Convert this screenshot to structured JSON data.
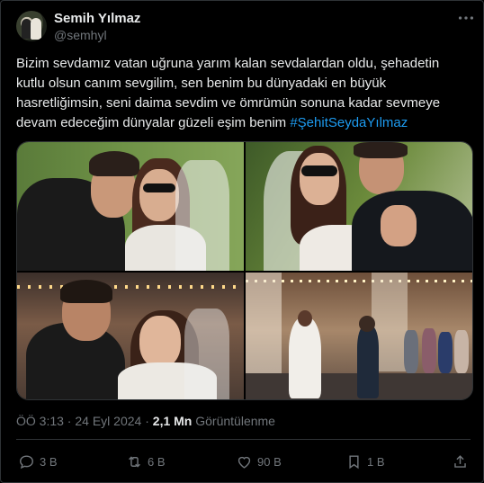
{
  "author": {
    "name": "Semih Yılmaz",
    "handle": "@semhyl",
    "avatar_icon": "profile-avatar"
  },
  "tweet": {
    "text": "Bizim sevdamız vatan uğruna yarım kalan sevdalardan oldu, şehadetin kutlu olsun canım sevgilim, sen benim bu dünyadaki en büyük hasretliğimsin, seni daima sevdim ve ömrümün sonuna kadar sevmeye devam edeceğim dünyalar güzeli eşim benim ",
    "hashtag": "#ŞehitSeydaYılmaz"
  },
  "meta": {
    "time": "ÖÖ 3:13",
    "separator": " · ",
    "date": "24 Eyl 2024",
    "views_count": "2,1 Mn",
    "views_label": "Görüntülenme"
  },
  "actions": {
    "replies": "3 B",
    "reposts": "6 B",
    "likes": "90 B",
    "bookmarks": "1 B"
  },
  "colors": {
    "background": "#000000",
    "text": "#e7e9ea",
    "muted": "#71767b",
    "link": "#1d9bf0",
    "border": "#2f3336"
  }
}
